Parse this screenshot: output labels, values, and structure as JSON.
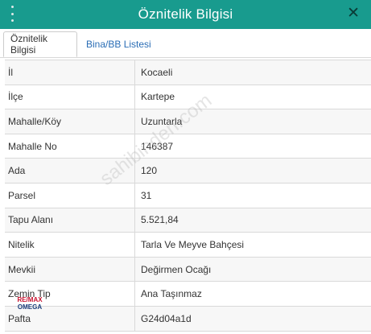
{
  "dialog": {
    "title": "Öznitelik Bilgisi",
    "close_symbol": "✕"
  },
  "tabs": [
    {
      "label": "Öznitelik Bilgisi",
      "active": true
    },
    {
      "label": "Bina/BB Listesi",
      "active": false
    }
  ],
  "rows": [
    {
      "key": "İl",
      "value": "Kocaeli"
    },
    {
      "key": "İlçe",
      "value": "Kartepe"
    },
    {
      "key": "Mahalle/Köy",
      "value": "Uzuntarla"
    },
    {
      "key": "Mahalle No",
      "value": "146387"
    },
    {
      "key": "Ada",
      "value": "120"
    },
    {
      "key": "Parsel",
      "value": "31"
    },
    {
      "key": "Tapu Alanı",
      "value": "5.521,84"
    },
    {
      "key": "Nitelik",
      "value": "Tarla Ve Meyve Bahçesi"
    },
    {
      "key": "Mevkii",
      "value": "Değirmen Ocağı"
    },
    {
      "key": "Zemin Tip",
      "value": "Ana Taşınmaz"
    },
    {
      "key": "Pafta",
      "value": "G24d04a1d"
    }
  ],
  "watermark": "sahibinden.com",
  "logo": {
    "line1": "RE/MAX",
    "line2": "OMEGA"
  },
  "colors": {
    "header": "#189b8e",
    "link": "#2a6db5"
  },
  "icons": {
    "menu": "vertical-dots-icon",
    "close": "close-icon"
  }
}
